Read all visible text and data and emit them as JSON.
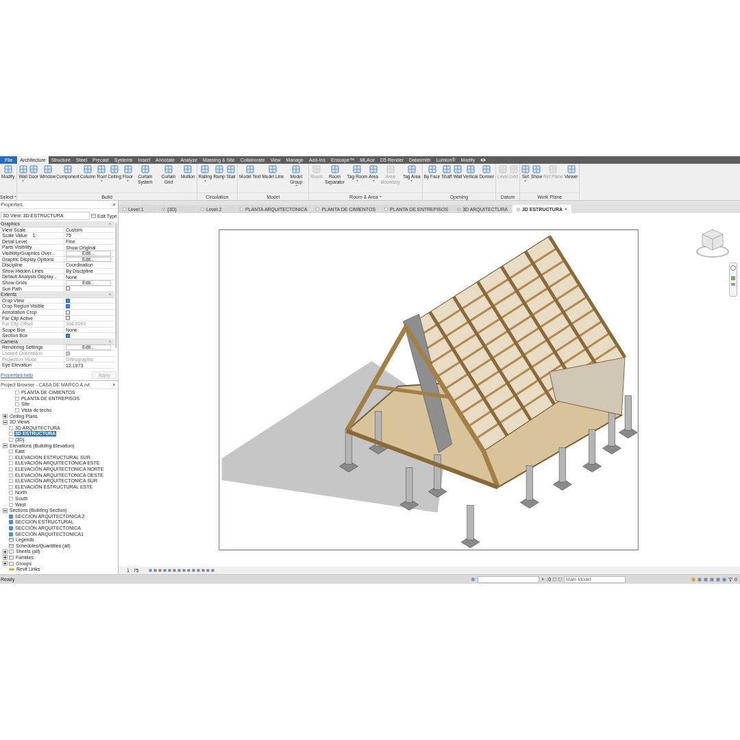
{
  "ribbon_tabs": [
    {
      "label": "File",
      "kind": "file",
      "selected": false
    },
    {
      "label": "Architecture",
      "kind": "tab",
      "selected": true
    },
    {
      "label": "Structure",
      "kind": "tab",
      "selected": false
    },
    {
      "label": "Steel",
      "kind": "tab",
      "selected": false
    },
    {
      "label": "Precast",
      "kind": "tab",
      "selected": false
    },
    {
      "label": "Systems",
      "kind": "tab",
      "selected": false
    },
    {
      "label": "Insert",
      "kind": "tab",
      "selected": false
    },
    {
      "label": "Annotate",
      "kind": "tab",
      "selected": false
    },
    {
      "label": "Analyze",
      "kind": "tab",
      "selected": false
    },
    {
      "label": "Massing & Site",
      "kind": "tab",
      "selected": false
    },
    {
      "label": "Collaborate",
      "kind": "tab",
      "selected": false
    },
    {
      "label": "View",
      "kind": "tab",
      "selected": false
    },
    {
      "label": "Manage",
      "kind": "tab",
      "selected": false
    },
    {
      "label": "Add-Ins",
      "kind": "tab",
      "selected": false
    },
    {
      "label": "Enscape™",
      "kind": "tab",
      "selected": false
    },
    {
      "label": "MLAce",
      "kind": "tab",
      "selected": false
    },
    {
      "label": "D5 Render",
      "kind": "tab",
      "selected": false
    },
    {
      "label": "Datasmith",
      "kind": "tab",
      "selected": false
    },
    {
      "label": "Lumion®",
      "kind": "tab",
      "selected": false
    },
    {
      "label": "Modify",
      "kind": "tab",
      "selected": false
    }
  ],
  "ribbon_groups": [
    {
      "label": "Select",
      "has_menu": true,
      "tools": [
        {
          "label": "Modify",
          "disabled": false,
          "has_menu": false
        }
      ]
    },
    {
      "label": "Build",
      "has_menu": false,
      "tools": [
        {
          "label": "Wall",
          "disabled": false,
          "has_menu": true
        },
        {
          "label": "Door",
          "disabled": false,
          "has_menu": false
        },
        {
          "label": "Window",
          "disabled": false,
          "has_menu": false
        },
        {
          "label": "Component",
          "disabled": false,
          "has_menu": false
        },
        {
          "label": "Column",
          "disabled": false,
          "has_menu": false
        },
        {
          "label": "Roof",
          "disabled": false,
          "has_menu": true
        },
        {
          "label": "Ceiling",
          "disabled": false,
          "has_menu": false
        },
        {
          "label": "Floor",
          "disabled": false,
          "has_menu": true
        },
        {
          "label": "Curtain System",
          "disabled": false,
          "has_menu": false
        },
        {
          "label": "Curtain Grid",
          "disabled": false,
          "has_menu": false
        },
        {
          "label": "Mullion",
          "disabled": false,
          "has_menu": false
        }
      ]
    },
    {
      "label": "Circulation",
      "has_menu": false,
      "tools": [
        {
          "label": "Railing",
          "disabled": false,
          "has_menu": true
        },
        {
          "label": "Ramp",
          "disabled": false,
          "has_menu": false
        },
        {
          "label": "Stair",
          "disabled": false,
          "has_menu": false
        }
      ]
    },
    {
      "label": "Model",
      "has_menu": false,
      "tools": [
        {
          "label": "Model Text",
          "disabled": false,
          "has_menu": false
        },
        {
          "label": "Model Line",
          "disabled": false,
          "has_menu": false
        },
        {
          "label": "Model Group",
          "disabled": false,
          "has_menu": true
        }
      ]
    },
    {
      "label": "Room & Area",
      "has_menu": true,
      "tools": [
        {
          "label": "Room",
          "disabled": true,
          "has_menu": false
        },
        {
          "label": "Room Separator",
          "disabled": false,
          "has_menu": false
        },
        {
          "label": "Tag Room",
          "disabled": false,
          "has_menu": true
        },
        {
          "label": "Area",
          "disabled": false,
          "has_menu": true
        },
        {
          "label": "Area Boundary",
          "disabled": true,
          "has_menu": false
        },
        {
          "label": "Tag Area",
          "disabled": false,
          "has_menu": true
        }
      ]
    },
    {
      "label": "Opening",
      "has_menu": false,
      "tools": [
        {
          "label": "By Face",
          "disabled": false,
          "has_menu": false
        },
        {
          "label": "Shaft",
          "disabled": false,
          "has_menu": false
        },
        {
          "label": "Wall",
          "disabled": false,
          "has_menu": false
        },
        {
          "label": "Vertical",
          "disabled": false,
          "has_menu": false
        },
        {
          "label": "Dormer",
          "disabled": false,
          "has_menu": false
        }
      ]
    },
    {
      "label": "Datum",
      "has_menu": false,
      "tools": [
        {
          "label": "Level",
          "disabled": true,
          "has_menu": false
        },
        {
          "label": "Grid",
          "disabled": true,
          "has_menu": false
        }
      ]
    },
    {
      "label": "Work Plane",
      "has_menu": false,
      "tools": [
        {
          "label": "Set",
          "disabled": false,
          "has_menu": true
        },
        {
          "label": "Show",
          "disabled": false,
          "has_menu": false
        },
        {
          "label": "Ref Plane",
          "disabled": true,
          "has_menu": false
        },
        {
          "label": "Viewer",
          "disabled": false,
          "has_menu": false
        }
      ]
    }
  ],
  "properties": {
    "title": "Properties",
    "type_selector": "3D View: 3D ESTRUCTURA",
    "edit_type": "Edit Type",
    "sections": [
      {
        "title": "Graphics",
        "rows": [
          {
            "kind": "text",
            "name": "View Scale",
            "value": "Custom",
            "disabled": false
          },
          {
            "kind": "text",
            "name": "Scale Value    1:",
            "value": "75",
            "disabled": false
          },
          {
            "kind": "text",
            "name": "Detail Level",
            "value": "Fine",
            "disabled": false
          },
          {
            "kind": "text",
            "name": "Parts Visibility",
            "value": "Show Original",
            "disabled": false
          },
          {
            "kind": "button",
            "name": "Visibility/Graphics Over...",
            "value": "Edit...",
            "disabled": false
          },
          {
            "kind": "button",
            "name": "Graphic Display Options",
            "value": "Edit...",
            "disabled": false
          },
          {
            "kind": "text",
            "name": "Discipline",
            "value": "Coordination",
            "disabled": false
          },
          {
            "kind": "text",
            "name": "Show Hidden Lines",
            "value": "By Discipline",
            "disabled": false
          },
          {
            "kind": "text",
            "name": "Default Analysis Display...",
            "value": "None",
            "disabled": false
          },
          {
            "kind": "button",
            "name": "Show Grids",
            "value": "Edit...",
            "disabled": false
          },
          {
            "kind": "checkbox",
            "name": "Sun Path",
            "checked": false,
            "disabled": false
          }
        ]
      },
      {
        "title": "Extents",
        "rows": [
          {
            "kind": "checkbox",
            "name": "Crop View",
            "checked": true,
            "disabled": false
          },
          {
            "kind": "checkbox",
            "name": "Crop Region Visible",
            "checked": true,
            "disabled": false
          },
          {
            "kind": "checkbox",
            "name": "Annotation Crop",
            "checked": false,
            "disabled": false
          },
          {
            "kind": "checkbox",
            "name": "Far Clip Active",
            "checked": false,
            "disabled": false
          },
          {
            "kind": "text",
            "name": "Far Clip Offset",
            "value": "304.0000",
            "disabled": true
          },
          {
            "kind": "text",
            "name": "Scope Box",
            "value": "None",
            "disabled": false
          },
          {
            "kind": "checkbox",
            "name": "Section Box",
            "checked": true,
            "disabled": false
          }
        ]
      },
      {
        "title": "Camera",
        "rows": [
          {
            "kind": "button",
            "name": "Rendering Settings",
            "value": "Edit...",
            "disabled": false
          },
          {
            "kind": "checkbox",
            "name": "Locked Orientation",
            "checked": true,
            "disabled": true
          },
          {
            "kind": "text",
            "name": "Projection Mode",
            "value": "Orthographic",
            "disabled": true
          },
          {
            "kind": "text",
            "name": "Eye Elevation",
            "value": "12.1973",
            "disabled": false
          }
        ]
      }
    ],
    "help_link": "Properties help",
    "apply_button": {
      "label": "Apply",
      "disabled": true
    }
  },
  "project_browser": {
    "title": "Project Browser - CASA DE MARCO A.rvt",
    "continued_items": [
      {
        "label": "PLANTA DE CIMIENTOS",
        "kind": "view",
        "selected": false
      },
      {
        "label": "PLANTA DE ENTREPISOS",
        "kind": "view",
        "selected": false
      },
      {
        "label": "Site",
        "kind": "view",
        "selected": false
      },
      {
        "label": "Vista de techo",
        "kind": "view",
        "selected": false
      }
    ],
    "items": [
      {
        "label": "Ceiling Plans",
        "kind": "folder",
        "expanded": false,
        "selected": false
      },
      {
        "label": "3D Views",
        "kind": "folder",
        "expanded": true,
        "selected": false,
        "children": [
          {
            "label": "3D ARQUITECTURA",
            "kind": "view",
            "selected": false
          },
          {
            "label": "3D ESTRUCTURA",
            "kind": "view",
            "selected": true
          },
          {
            "label": "{3D}",
            "kind": "view",
            "selected": false
          }
        ]
      },
      {
        "label": "Elevations (Building Elevation)",
        "kind": "folder",
        "expanded": true,
        "selected": false,
        "children": [
          {
            "label": "East",
            "kind": "view",
            "selected": false
          },
          {
            "label": "ELEVACION ESTRUCTURAL SUR",
            "kind": "view",
            "selected": false
          },
          {
            "label": "ELEVACIÓN ARQUITECTONICA ESTE",
            "kind": "view",
            "selected": false
          },
          {
            "label": "ELEVACIÓN ARQUITECTONICA NORTE",
            "kind": "view",
            "selected": false
          },
          {
            "label": "ELEVACIÓN ARQUITECTONICA OESTE",
            "kind": "view",
            "selected": false
          },
          {
            "label": "ELEVACIÓN ARQUITECTONICA SUR",
            "kind": "view",
            "selected": false
          },
          {
            "label": "ELEVACIÓN ESTRUCTURAL ESTE",
            "kind": "view",
            "selected": false
          },
          {
            "label": "North",
            "kind": "view",
            "selected": false
          },
          {
            "label": "South",
            "kind": "view",
            "selected": false
          },
          {
            "label": "West",
            "kind": "view",
            "selected": false
          }
        ]
      },
      {
        "label": "Sections (Building Section)",
        "kind": "folder",
        "expanded": true,
        "selected": false,
        "children": [
          {
            "label": "SECCION ARQUITECTONICA 2",
            "kind": "section",
            "selected": false
          },
          {
            "label": "SECCION ESTRUCTURAL",
            "kind": "section",
            "selected": false
          },
          {
            "label": "SECCIÓN ARQUITECTONICA",
            "kind": "section",
            "selected": false
          },
          {
            "label": "SECCIÓN ARQUITECTONICA1",
            "kind": "section",
            "selected": false
          }
        ]
      },
      {
        "label": "Legends",
        "kind": "category",
        "selected": false
      },
      {
        "label": "Schedules/Quantities (all)",
        "kind": "category",
        "selected": false
      },
      {
        "label": "Sheets (all)",
        "kind": "folder",
        "expanded": false,
        "selected": false
      },
      {
        "label": "Families",
        "kind": "folder",
        "expanded": false,
        "selected": false
      },
      {
        "label": "Groups",
        "kind": "folder",
        "expanded": false,
        "selected": false
      },
      {
        "label": "Revit Links",
        "kind": "link",
        "selected": false
      }
    ]
  },
  "view_tabs": [
    {
      "label": "Level 1",
      "kind": "plan",
      "selected": false
    },
    {
      "label": "{3D}",
      "kind": "model",
      "selected": false
    },
    {
      "label": "Level 2",
      "kind": "plan",
      "selected": false
    },
    {
      "label": "PLANTA ARQUITECTONICA",
      "kind": "plan",
      "selected": false
    },
    {
      "label": "PLANTA DE CIMIENTOS",
      "kind": "plan",
      "selected": false
    },
    {
      "label": "PLANTA DE ENTREPISOS",
      "kind": "plan",
      "selected": false
    },
    {
      "label": "3D ARQUITECTURA",
      "kind": "model",
      "selected": false
    },
    {
      "label": "3D ESTRUCTURA",
      "kind": "model",
      "selected": true
    }
  ],
  "view_control_bar": {
    "scale": "1 : 75"
  },
  "status_bar": {
    "message": "Ready",
    "selection_count": ":0",
    "model_field": "Main Model",
    "filter_count": "0"
  }
}
